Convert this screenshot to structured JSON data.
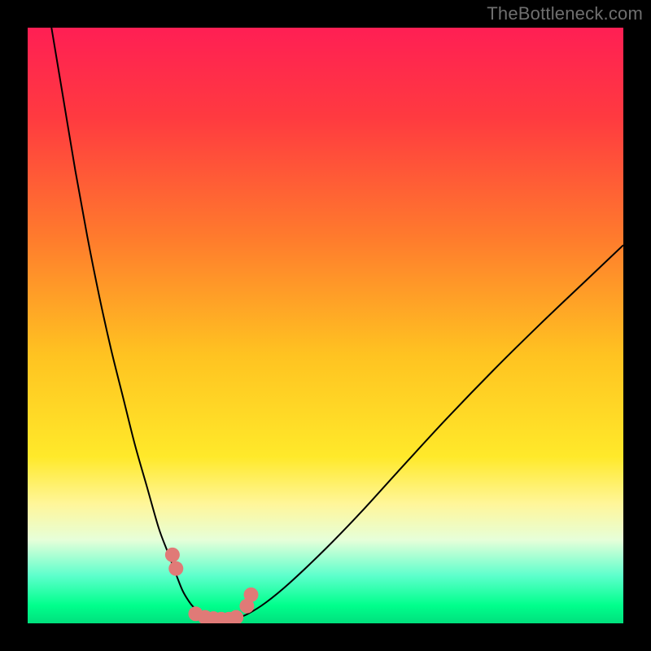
{
  "watermark": {
    "text": "TheBottleneck.com"
  },
  "chart_data": {
    "type": "line",
    "title": "",
    "xlabel": "",
    "ylabel": "",
    "xlim": [
      0,
      100
    ],
    "ylim": [
      0,
      100
    ],
    "grid": false,
    "legend": false,
    "background_gradient": {
      "stops": [
        {
          "offset": 0,
          "color": "#ff1f54"
        },
        {
          "offset": 0.15,
          "color": "#ff3a40"
        },
        {
          "offset": 0.35,
          "color": "#ff7a2d"
        },
        {
          "offset": 0.55,
          "color": "#ffc321"
        },
        {
          "offset": 0.72,
          "color": "#ffe92a"
        },
        {
          "offset": 0.8,
          "color": "#fff69a"
        },
        {
          "offset": 0.86,
          "color": "#e6ffd9"
        },
        {
          "offset": 0.92,
          "color": "#5dffcc"
        },
        {
          "offset": 0.97,
          "color": "#00ff8c"
        },
        {
          "offset": 1.0,
          "color": "#00e07d"
        }
      ]
    },
    "series": [
      {
        "name": "curve",
        "color": "#000000",
        "stroke_width": 2,
        "x": [
          4,
          6,
          8,
          10,
          12,
          14,
          16,
          18,
          20,
          22,
          23.5,
          25,
          26,
          27,
          28,
          30,
          32,
          33,
          34,
          35,
          37,
          40,
          44,
          50,
          56,
          62,
          70,
          78,
          86,
          94,
          100
        ],
        "y": [
          100,
          88,
          76,
          65,
          55,
          46,
          38,
          30,
          23,
          16,
          12,
          8,
          5.5,
          3.8,
          2.6,
          1.4,
          0.8,
          0.6,
          0.6,
          0.8,
          1.6,
          3.5,
          6.8,
          12.5,
          18.7,
          25.3,
          34.0,
          42.3,
          50.2,
          57.8,
          63.5
        ]
      }
    ],
    "markers": {
      "name": "dots",
      "color": "#e07a77",
      "radius": 9,
      "x": [
        24.3,
        24.9,
        28.2,
        29.8,
        31.2,
        32.5,
        33.8,
        35.0,
        36.8,
        37.5
      ],
      "y": [
        11.5,
        9.2,
        1.6,
        1.0,
        0.8,
        0.7,
        0.7,
        1.0,
        2.9,
        4.8
      ]
    }
  }
}
